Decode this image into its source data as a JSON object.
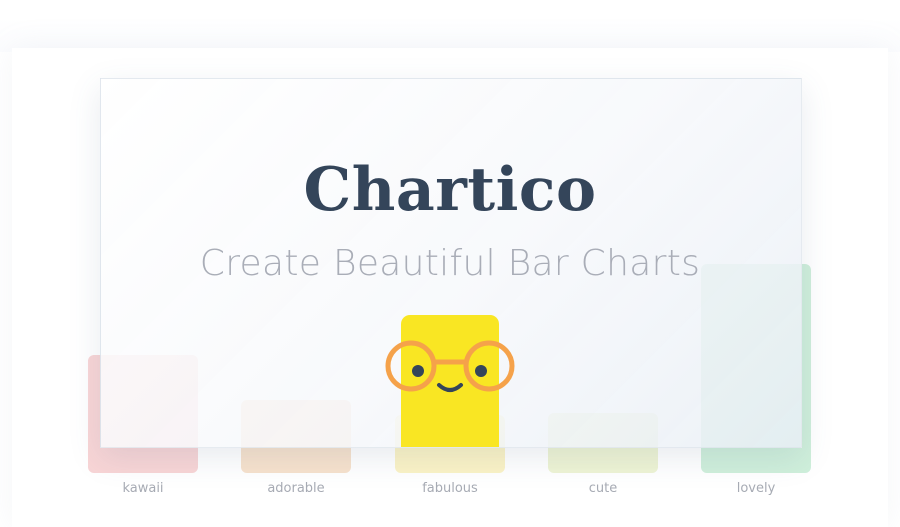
{
  "hero": {
    "title": "Chartico",
    "subtitle": "Create Beautiful Bar Charts"
  },
  "bars": [
    {
      "label": "kawaii",
      "color": "#f8d5d6"
    },
    {
      "label": "adorable",
      "color": "#f7e2cd"
    },
    {
      "label": "fabulous",
      "color": "#f9e623"
    },
    {
      "label": "cute",
      "color": "#eef4d4"
    },
    {
      "label": "lovely",
      "color": "#cfefdb"
    }
  ],
  "mascot": {
    "icon": "nerd-face-icon",
    "glasses_color": "#f5a24a",
    "body_color": "#f9e623"
  }
}
